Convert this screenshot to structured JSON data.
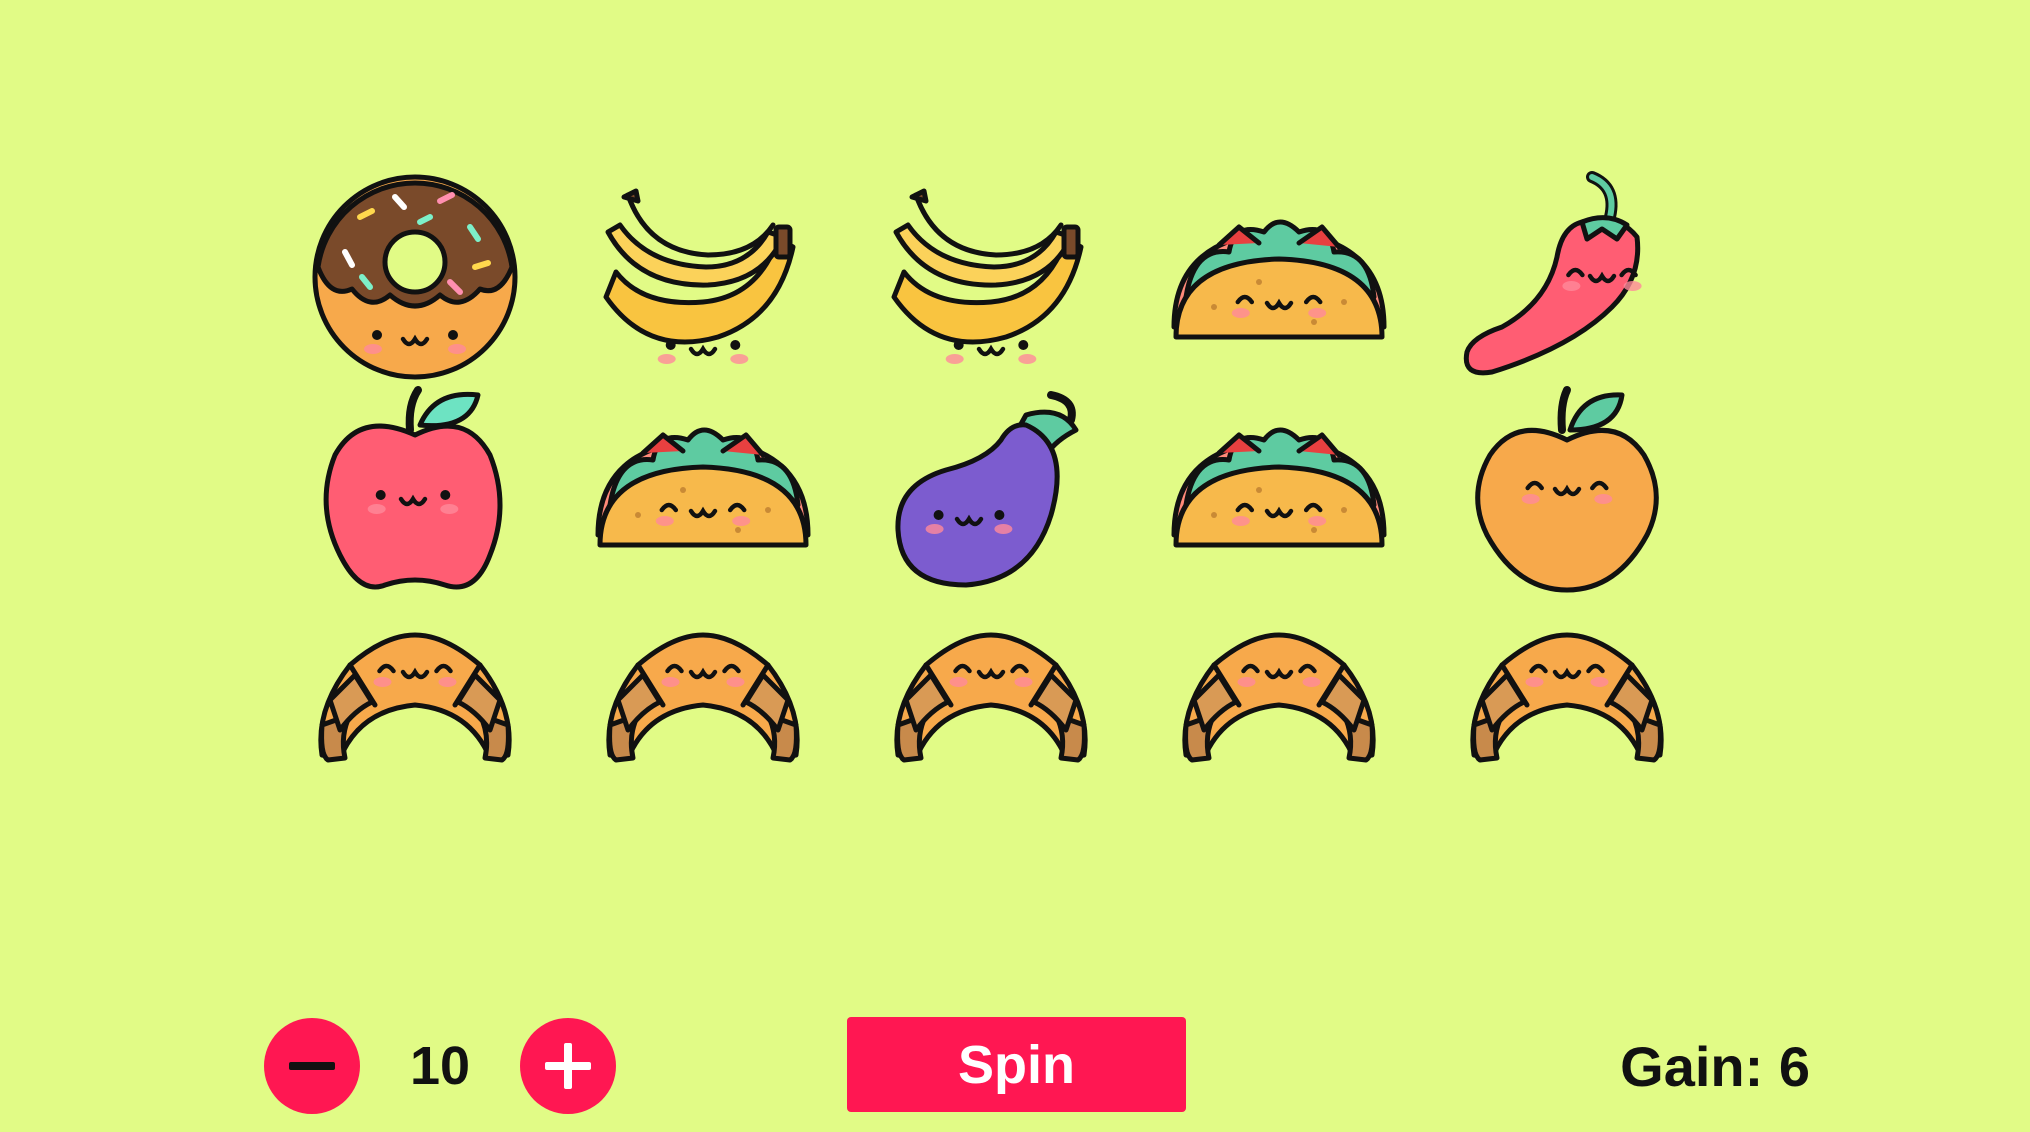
{
  "colors": {
    "background": "#e1fb86",
    "accent": "#ff1752",
    "outline": "#111111"
  },
  "reels": [
    [
      "donut-icon",
      "apple-icon",
      "croissant-icon"
    ],
    [
      "banana-icon",
      "taco-icon",
      "croissant-icon"
    ],
    [
      "banana-icon",
      "eggplant-icon",
      "croissant-icon"
    ],
    [
      "taco-icon",
      "taco-icon",
      "croissant-icon"
    ],
    [
      "chili-pepper-icon",
      "peach-icon",
      "croissant-icon"
    ]
  ],
  "controls": {
    "decrease_icon": "minus-icon",
    "increase_icon": "plus-icon",
    "bet": "10",
    "spin_label": "Spin",
    "gain_text": "Gain: 6"
  }
}
